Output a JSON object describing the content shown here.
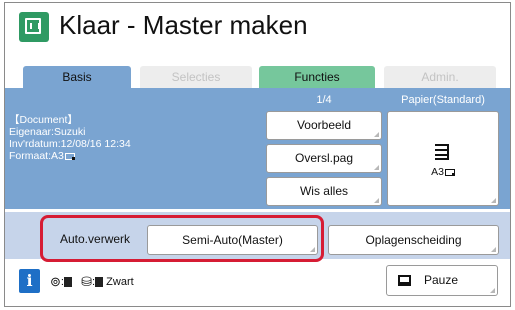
{
  "header": {
    "title": "Klaar - Master maken"
  },
  "tabs": [
    {
      "label": "Basis",
      "state": "active"
    },
    {
      "label": "Selecties",
      "state": "disabled"
    },
    {
      "label": "Functies",
      "state": "enabled"
    },
    {
      "label": "Admin.",
      "state": "disabled"
    }
  ],
  "document": {
    "heading": "【Document】",
    "owner": "Eigenaar:Suzuki",
    "date": "Inv'rdatum:12/08/16 12:34",
    "format": "Formaat:A3"
  },
  "page_indicator": "1/4",
  "paper": {
    "label": "Papier(Standard)",
    "size": "A3"
  },
  "buttons": {
    "voorbeeld": "Voorbeeld",
    "oversl": "Oversl.pag",
    "wis": "Wis alles",
    "semi_auto": "Semi-Auto(Master)",
    "opl": "Oplagenscheiding",
    "pauze": "Pauze"
  },
  "auto_label": "Auto.verwerk",
  "status": {
    "ink_color": "Zwart",
    "info": "i"
  },
  "colors": {
    "accent_blue": "#7aa4d1",
    "tab_green": "#76c79c",
    "highlight_red": "#d61c34",
    "title_icon": "#2f9a63"
  }
}
